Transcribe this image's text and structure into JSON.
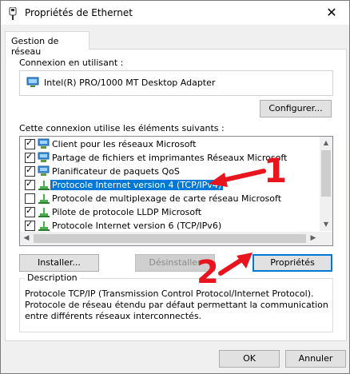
{
  "window": {
    "title": "Propriétés de Ethernet",
    "close_glyph": "✕"
  },
  "tabs": [
    {
      "label": "Gestion de réseau"
    }
  ],
  "connection": {
    "label": "Connexion en utilisant :",
    "adapter": "Intel(R) PRO/1000 MT Desktop Adapter",
    "configure_label": "Configurer..."
  },
  "items_label": "Cette connexion utilise les éléments suivants :",
  "items": [
    {
      "label": "Client pour les réseaux Microsoft",
      "checked": true,
      "icon": "network-client-icon"
    },
    {
      "label": "Partage de fichiers et imprimantes Réseaux Microsoft",
      "checked": true,
      "icon": "network-share-icon"
    },
    {
      "label": "Planificateur de paquets QoS",
      "checked": true,
      "icon": "network-service-icon"
    },
    {
      "label": "Protocole Internet version 4 (TCP/IPv4)",
      "checked": true,
      "icon": "protocol-icon",
      "selected": true
    },
    {
      "label": "Protocole de multiplexage de carte réseau Microsoft",
      "checked": false,
      "icon": "protocol-icon"
    },
    {
      "label": "Pilote de protocole LLDP Microsoft",
      "checked": true,
      "icon": "protocol-icon"
    },
    {
      "label": "Protocole Internet version 6 (TCP/IPv6)",
      "checked": true,
      "icon": "protocol-icon"
    }
  ],
  "actions": {
    "install": "Installer...",
    "uninstall": "Désinstaller",
    "properties": "Propriétés"
  },
  "description": {
    "title": "Description",
    "text": "Protocole TCP/IP (Transmission Control Protocol/Internet Protocol). Protocole de réseau étendu par défaut permettant la communication entre différents réseaux interconnectés."
  },
  "footer": {
    "ok": "OK",
    "cancel": "Annuler"
  },
  "annotations": {
    "step1": "1",
    "step2": "2",
    "color": "#e8141e"
  },
  "colors": {
    "selection": "#0078d7",
    "background": "#f0f0f0"
  }
}
